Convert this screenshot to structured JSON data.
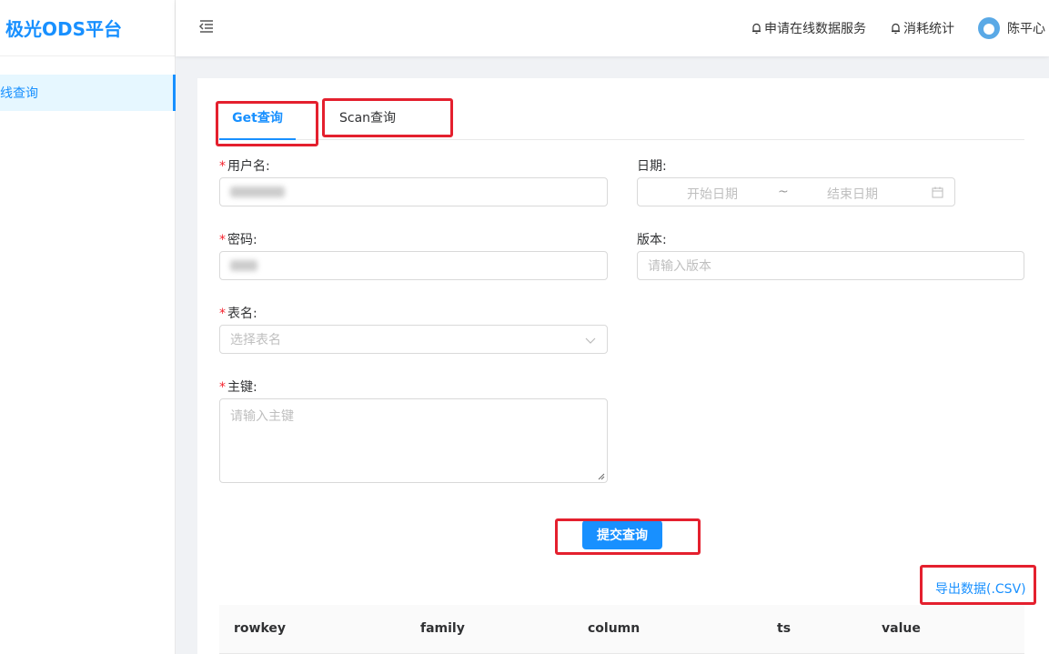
{
  "app": {
    "title": "极光ODS平台"
  },
  "sidebar": {
    "items": [
      {
        "label": "线查询",
        "active": true
      }
    ]
  },
  "header": {
    "links": [
      {
        "label": "申请在线数据服务",
        "icon": "bell-icon"
      },
      {
        "label": "消耗统计",
        "icon": "bell-icon"
      }
    ],
    "user": {
      "name": "陈平心"
    }
  },
  "tabs": [
    {
      "label": "Get查询",
      "active": true
    },
    {
      "label": "Scan查询",
      "active": false
    }
  ],
  "form": {
    "username": {
      "label": "用户名:",
      "value": ""
    },
    "password": {
      "label": "密码:",
      "value": ""
    },
    "table": {
      "label": "表名:",
      "placeholder": "选择表名"
    },
    "rowkey": {
      "label": "主键:",
      "placeholder": "请输入主键"
    },
    "date": {
      "label": "日期:",
      "start_placeholder": "开始日期",
      "separator": "~",
      "end_placeholder": "结束日期"
    },
    "version": {
      "label": "版本:",
      "placeholder": "请输入版本"
    },
    "submit_label": "提交查询"
  },
  "export_label": "导出数据(.CSV)",
  "table": {
    "columns": [
      "rowkey",
      "family",
      "column",
      "ts",
      "value"
    ]
  },
  "colors": {
    "accent": "#1890ff",
    "required": "#f5222d",
    "highlight_box": "#e4202e"
  }
}
